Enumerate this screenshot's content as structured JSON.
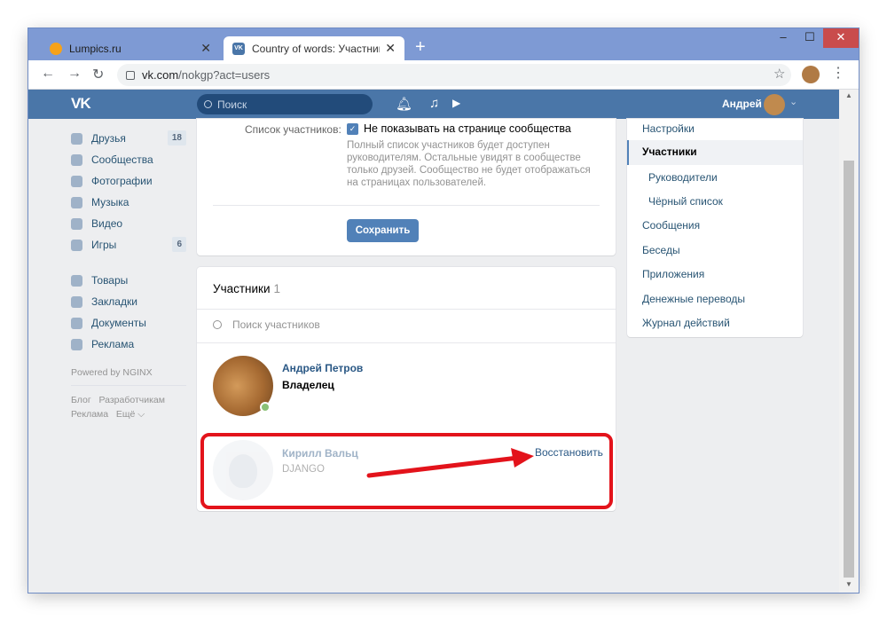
{
  "browser": {
    "tabs": [
      {
        "title": "Lumpics.ru",
        "close": "✕"
      },
      {
        "title": "Country of words: Участники",
        "close": "✕"
      }
    ],
    "new_tab": "+",
    "address_host": "vk.com",
    "address_path": "/nokgp?act=users",
    "window_controls": {
      "minimize": "–",
      "maximize": "☐",
      "close": "✕"
    }
  },
  "vk_header": {
    "logo": "VK",
    "search_placeholder": "Поиск",
    "user_name": "Андрей"
  },
  "left_menu": {
    "items": [
      {
        "label": "Друзья",
        "count": "18"
      },
      {
        "label": "Сообщества",
        "count": ""
      },
      {
        "label": "Фотографии",
        "count": ""
      },
      {
        "label": "Музыка",
        "count": ""
      },
      {
        "label": "Видео",
        "count": ""
      },
      {
        "label": "Игры",
        "count": "6"
      }
    ],
    "items2": [
      {
        "label": "Товары"
      },
      {
        "label": "Закладки"
      },
      {
        "label": "Документы"
      },
      {
        "label": "Реклама"
      }
    ],
    "powered": "Powered by NGINX",
    "footer": {
      "blog": "Блог",
      "dev": "Разработчикам",
      "ads": "Реклама",
      "more": "Ещё ⌵"
    }
  },
  "settings_card": {
    "row_label": "Список участников:",
    "checkbox_label": "Не показывать на странице сообщества",
    "checkbox_checked": true,
    "description": "Полный список участников будет доступен руководителям. Остальные увидят в сообществе только друзей. Сообщество не будет отображаться на страницах пользователей.",
    "save_button": "Сохранить"
  },
  "members_card": {
    "title": "Участники",
    "count": "1",
    "search_placeholder": "Поиск участников",
    "members": [
      {
        "name": "Андрей Петров",
        "role": "Владелец",
        "online": true
      },
      {
        "name": "Кирилл Вальц",
        "subtitle": "DJANGO",
        "action": "Восстановить"
      }
    ]
  },
  "right_menu": {
    "items": [
      {
        "label": "Настройки"
      },
      {
        "label": "Участники",
        "active": true
      },
      {
        "label": "Руководители",
        "sub": true
      },
      {
        "label": "Чёрный список",
        "sub": true
      },
      {
        "label": "Сообщения"
      },
      {
        "label": "Беседы"
      },
      {
        "label": "Приложения"
      },
      {
        "label": "Денежные переводы"
      },
      {
        "label": "Журнал действий"
      }
    ]
  },
  "colors": {
    "vk_blue": "#4a76a8",
    "button": "#5181b8",
    "highlight": "#e3131b",
    "browser_frame": "#7e9ad4"
  }
}
